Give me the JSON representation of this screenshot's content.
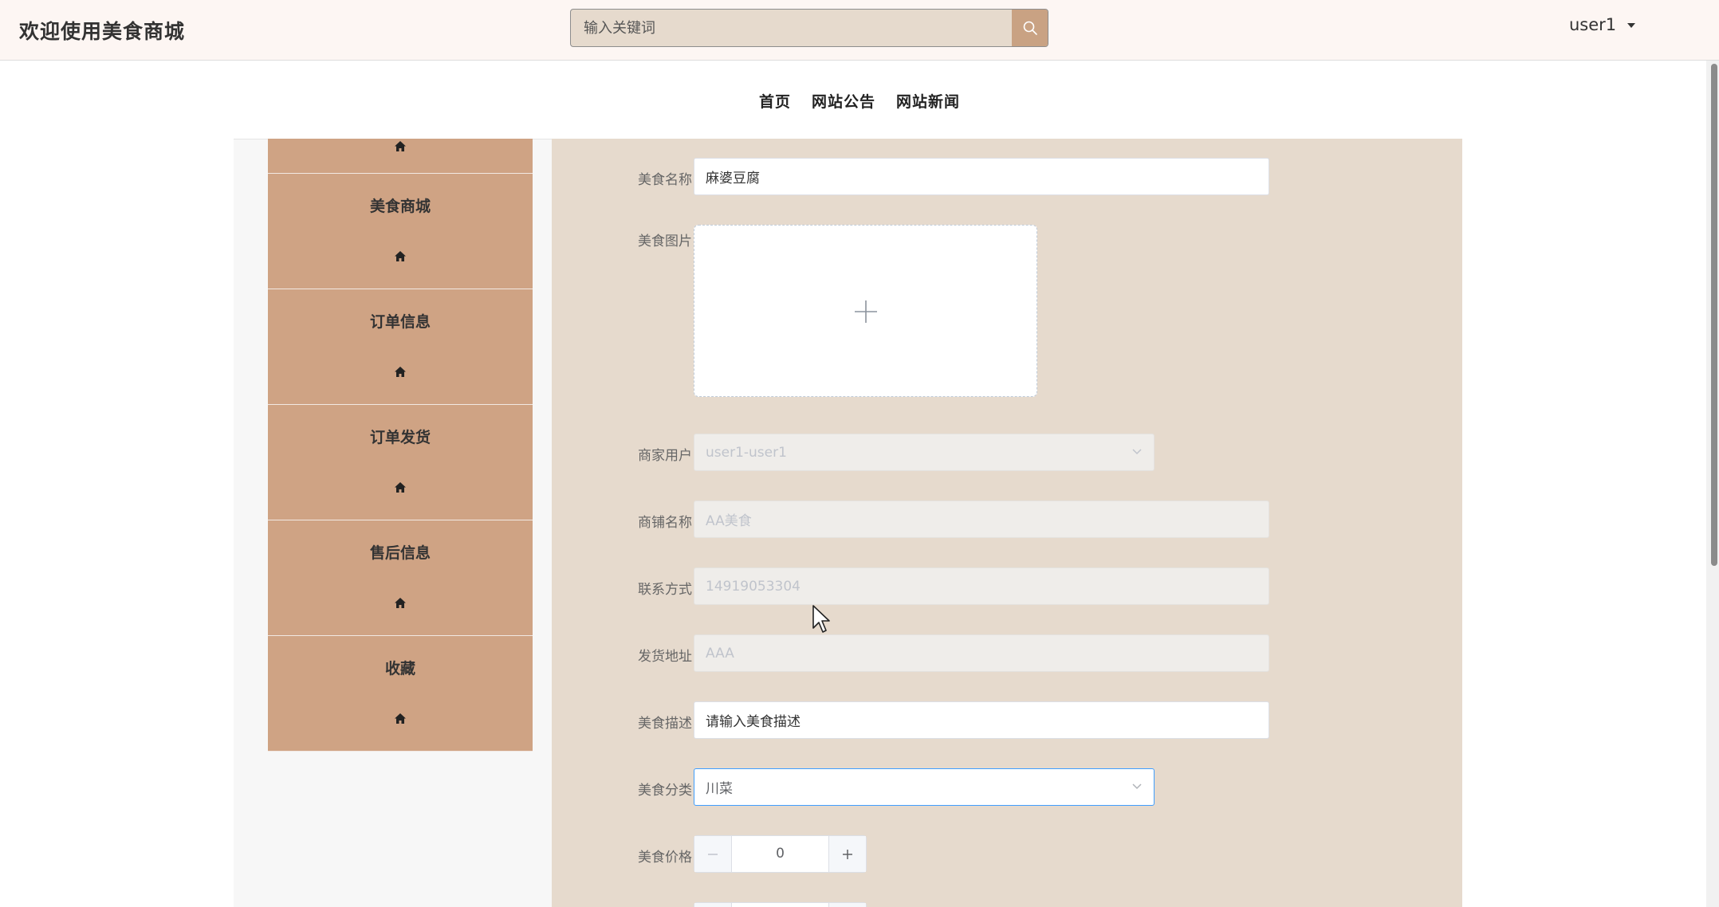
{
  "header": {
    "brand": "欢迎使用美食商城",
    "search_placeholder": "输入关键词",
    "user": "user1"
  },
  "nav": {
    "items": [
      "首页",
      "网站公告",
      "网站新闻"
    ]
  },
  "sidebar": {
    "items": [
      {
        "label": "美食商城"
      },
      {
        "label": "订单信息"
      },
      {
        "label": "订单发货"
      },
      {
        "label": "售后信息"
      },
      {
        "label": "收藏"
      }
    ]
  },
  "form": {
    "name_label": "美食名称",
    "name_value": "麻婆豆腐",
    "image_label": "美食图片",
    "merchant_label": "商家用户",
    "merchant_value": "user1-user1",
    "shop_label": "商铺名称",
    "shop_value": "AA美食",
    "contact_label": "联系方式",
    "contact_value": "14919053304",
    "address_label": "发货地址",
    "address_value": "AAA",
    "desc_label": "美食描述",
    "desc_placeholder": "请输入美食描述",
    "category_label": "美食分类",
    "category_value": "川菜",
    "price_label": "美食价格",
    "price_value": "0"
  },
  "colors": {
    "accent": "#cfa384",
    "panel": "#e6dacd",
    "search_button": "#c9a283"
  }
}
